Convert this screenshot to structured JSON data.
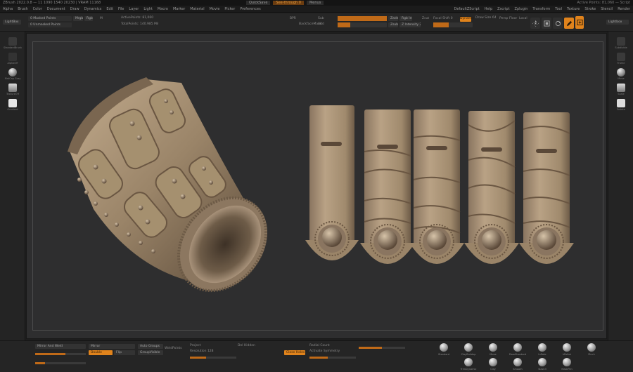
{
  "titlebar": {
    "app_title": "ZBrush 2022.0.8 — 11 1090 1540 20230 | VRAM 11168",
    "center_items": [
      "QuickSave",
      "See-through 0",
      "Menus"
    ],
    "right_text": "Active Points: 81,060 — Script"
  },
  "menubar": {
    "items": [
      "Alpha",
      "Brush",
      "Color",
      "Document",
      "Draw",
      "Dynamics",
      "Edit",
      "File",
      "Layer",
      "Light",
      "Macro",
      "Marker",
      "Material",
      "Movie",
      "Picker",
      "Preferences",
      "Render",
      "Stencil",
      "Stroke",
      "Texture",
      "Tool",
      "Transform",
      "Zplugin",
      "Zscript",
      "Help"
    ],
    "right_items": [
      "DefaultZScript",
      "Help",
      "Zscript",
      "Zplugin",
      "Transform",
      "Tool",
      "Texture",
      "Stroke",
      "Stencil",
      "Render",
      "Preferences",
      "Picker",
      "Movie",
      "Material",
      "Marker",
      "Macro",
      "Light",
      "Layer"
    ]
  },
  "topshelf": {
    "lightbox_label": "LightBox",
    "masked_points": "0 Masked Points",
    "unmasked_points": "0 Unmasked Points",
    "mrgb": "Mrgb",
    "rgb": "Rgb",
    "m": "M",
    "active_points": "ActivePoints: 81,060",
    "total_points": "TotalPoints: 140.985 Mil",
    "bpr_label": "BPR",
    "backface_mask": "BackfaceMask",
    "sub_label": "Sub",
    "add_label": "Add",
    "zadd": "Zadd",
    "zsub": "Zsub",
    "zcut": "Zcut",
    "focal_shift": "Focal Shift 0",
    "draw_size": "Draw Size 64",
    "z_intensity": "Z Intensity 25",
    "rgb_intensity": "Rgb Intensity 100",
    "rgb_intensity_fill": 1.0,
    "z_intensity_fill": 0.25,
    "draw_size_fill": 0.4,
    "dynamic": "Dynamic",
    "persp": "Persp",
    "floor": "Floor",
    "local": "Local",
    "xyz": "Xyz",
    "tool_icons": [
      "move-icon",
      "scale-icon",
      "rotate-icon",
      "draw-icon",
      "edit-icon"
    ]
  },
  "lefttray": {
    "tab": "LightBox",
    "items": [
      "StandardBrush",
      "AlphaOff",
      "TextureOff",
      "MatCap Gray",
      "Gradient"
    ]
  },
  "righttray": {
    "tab": "Lightbox",
    "items": [
      "Subdivide",
      "Frame",
      "Move",
      "Scale",
      "Rotate",
      "PolyF"
    ]
  },
  "bottomshelf": {
    "mirror_weld": "Mirror And Weld",
    "mirror": "Mirror",
    "auto_groups": "Auto Groups",
    "weld_points": "WeldPoints",
    "double": "Double",
    "flip": "Flip",
    "group_visible": "GroupVisible",
    "project": "Project",
    "resolution": "Resolution 128",
    "delete_hidden": "Del Hidden",
    "close_holes": "Close Holes",
    "radial_count": "Radial Count",
    "activate_symmetry": "Activate Symmetry",
    "brushes": [
      "Standard",
      "ClayBuildup",
      "Move",
      "DamStandard",
      "Inflate",
      "hPolish",
      "Pinch",
      "TrimDynamic",
      "Clay",
      "Smooth",
      "Slash3",
      "MaskPen"
    ]
  },
  "viewport": {
    "model_name": "Leather bracer with straps",
    "colors": {
      "background": "#2e2e2f",
      "leather_light": "#b59d80",
      "leather_mid": "#8a7560",
      "leather_dark": "#4a3c2e",
      "accent": "#e0831c"
    }
  }
}
